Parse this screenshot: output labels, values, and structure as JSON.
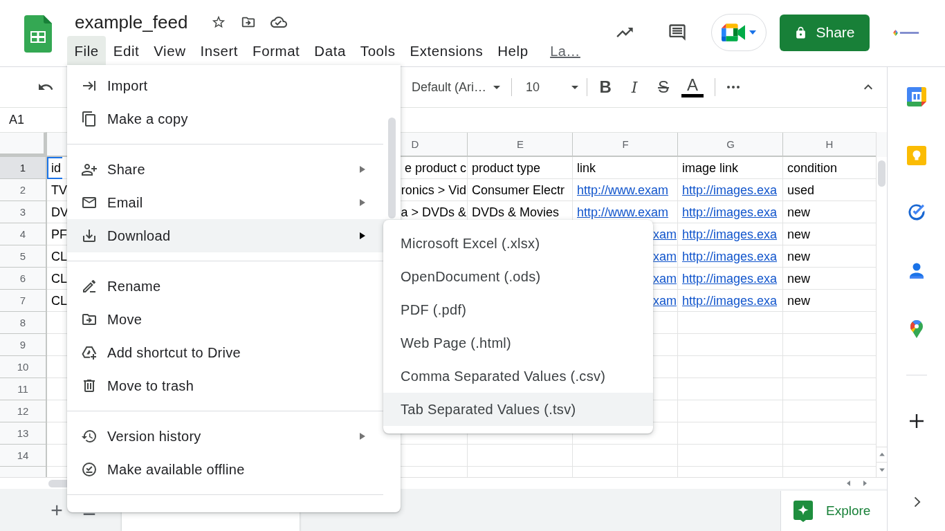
{
  "document": {
    "title": "example_feed"
  },
  "menu_bar": {
    "items": [
      {
        "label": "File",
        "selected": true
      },
      {
        "label": "Edit",
        "selected": false
      },
      {
        "label": "View",
        "selected": false
      },
      {
        "label": "Insert",
        "selected": false
      },
      {
        "label": "Format",
        "selected": false
      },
      {
        "label": "Data",
        "selected": false
      },
      {
        "label": "Tools",
        "selected": false
      },
      {
        "label": "Extensions",
        "selected": false
      },
      {
        "label": "Help",
        "selected": false
      }
    ],
    "last_edit": "La…"
  },
  "share_button": {
    "label": "Share"
  },
  "toolbar": {
    "font": "Default (Ari…",
    "font_size": "10",
    "format_buttons": [
      {
        "kind": "bold",
        "label": "B"
      },
      {
        "kind": "italic",
        "label": "I"
      },
      {
        "kind": "strikethrough",
        "label": "S"
      },
      {
        "kind": "text_color",
        "label": "A"
      }
    ]
  },
  "name_box": "A1",
  "grid": {
    "column_headers": [
      "D",
      "E",
      "F",
      "G",
      "H"
    ],
    "rows": [
      {
        "number": "1",
        "selected": true
      },
      {
        "number": "2",
        "selected": false
      },
      {
        "number": "3",
        "selected": false
      },
      {
        "number": "4",
        "selected": false
      },
      {
        "number": "5",
        "selected": false
      },
      {
        "number": "6",
        "selected": false
      },
      {
        "number": "7",
        "selected": false
      },
      {
        "number": "8",
        "selected": false
      },
      {
        "number": "9",
        "selected": false
      },
      {
        "number": "10",
        "selected": false
      },
      {
        "number": "11",
        "selected": false
      },
      {
        "number": "12",
        "selected": false
      },
      {
        "number": "13",
        "selected": false
      },
      {
        "number": "14",
        "selected": false
      }
    ],
    "columns": [
      {
        "cells": [
          {
            "text": "id",
            "link": false,
            "selected": true
          },
          {
            "text": "TV",
            "link": false,
            "selected": false
          },
          {
            "text": "DV",
            "link": false,
            "selected": false
          },
          {
            "text": "PF",
            "link": false,
            "selected": false
          },
          {
            "text": "CL",
            "link": false,
            "selected": false
          },
          {
            "text": "CL",
            "link": false,
            "selected": false
          },
          {
            "text": "CL",
            "link": false,
            "selected": false
          }
        ]
      },
      {
        "cells": [
          {
            "text": "e product c",
            "link": false,
            "selected": false
          },
          {
            "text": "ronics > Vid",
            "link": false,
            "selected": false
          },
          {
            "text": "a > DVDs &",
            "link": false,
            "selected": false
          }
        ]
      },
      {
        "cells": [
          {
            "text": "product type",
            "link": false,
            "selected": false
          },
          {
            "text": "Consumer Electr",
            "link": false,
            "selected": false
          },
          {
            "text": "DVDs & Movies",
            "link": false,
            "selected": false
          }
        ]
      },
      {
        "cells": [
          {
            "text": "link",
            "link": false,
            "selected": false
          },
          {
            "text": "http://www.exam",
            "link": true,
            "selected": false
          },
          {
            "text": "http://www.exam",
            "link": true,
            "selected": false
          },
          {
            "text": "xam",
            "link": true,
            "selected": false
          },
          {
            "text": "xam",
            "link": true,
            "selected": false
          },
          {
            "text": "xam",
            "link": true,
            "selected": false
          },
          {
            "text": "xam",
            "link": true,
            "selected": false
          }
        ]
      },
      {
        "cells": [
          {
            "text": "image link",
            "link": false,
            "selected": false
          },
          {
            "text": "http://images.exa",
            "link": true,
            "selected": false
          },
          {
            "text": "http://images.exa",
            "link": true,
            "selected": false
          },
          {
            "text": "http://images.exa",
            "link": true,
            "selected": false
          },
          {
            "text": "http://images.exa",
            "link": true,
            "selected": false
          },
          {
            "text": "http://images.exa",
            "link": true,
            "selected": false
          },
          {
            "text": "http://images.exa",
            "link": true,
            "selected": false
          }
        ]
      },
      {
        "cells": [
          {
            "text": "condition",
            "link": false,
            "selected": false
          },
          {
            "text": "used",
            "link": false,
            "selected": false
          },
          {
            "text": "new",
            "link": false,
            "selected": false
          },
          {
            "text": "new",
            "link": false,
            "selected": false
          },
          {
            "text": "new",
            "link": false,
            "selected": false
          },
          {
            "text": "new",
            "link": false,
            "selected": false
          },
          {
            "text": "new",
            "link": false,
            "selected": false
          }
        ]
      }
    ]
  },
  "file_menu": {
    "groups": [
      {
        "items": [
          {
            "label": "Import",
            "has_submenu": false,
            "selected": false
          },
          {
            "label": "Make a copy",
            "has_submenu": false,
            "selected": false
          }
        ]
      },
      {
        "items": [
          {
            "label": "Share",
            "has_submenu": true,
            "selected": false
          },
          {
            "label": "Email",
            "has_submenu": true,
            "selected": false
          },
          {
            "label": "Download",
            "has_submenu": true,
            "selected": true
          }
        ]
      },
      {
        "items": [
          {
            "label": "Rename",
            "has_submenu": false,
            "selected": false
          },
          {
            "label": "Move",
            "has_submenu": false,
            "selected": false
          },
          {
            "label": "Add shortcut to Drive",
            "has_submenu": false,
            "selected": false
          },
          {
            "label": "Move to trash",
            "has_submenu": false,
            "selected": false
          }
        ]
      },
      {
        "items": [
          {
            "label": "Version history",
            "has_submenu": true,
            "selected": false
          },
          {
            "label": "Make available offline",
            "has_submenu": false,
            "selected": false
          }
        ]
      }
    ]
  },
  "download_menu": {
    "items": [
      {
        "label": "Microsoft Excel (.xlsx)",
        "selected": false
      },
      {
        "label": "OpenDocument (.ods)",
        "selected": false
      },
      {
        "label": "PDF (.pdf)",
        "selected": false
      },
      {
        "label": "Web Page (.html)",
        "selected": false
      },
      {
        "label": "Comma Separated Values (.csv)",
        "selected": false
      },
      {
        "label": "Tab Separated Values (.tsv)",
        "selected": true
      }
    ]
  },
  "explore_button": {
    "label": "Explore"
  }
}
